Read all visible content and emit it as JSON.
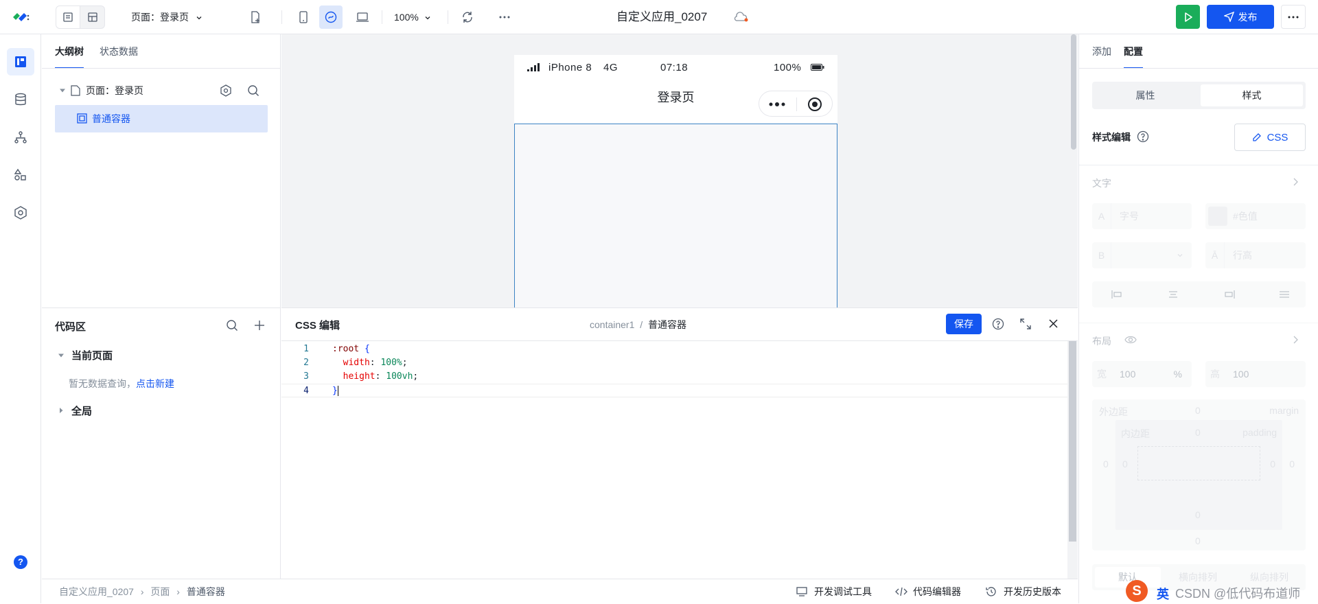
{
  "header": {
    "page_select": "页面：登录页",
    "zoom": "100%",
    "app_title": "自定义应用_0207",
    "publish_label": "发布"
  },
  "outline": {
    "tabs": [
      "大纲树",
      "状态数据"
    ],
    "tree": {
      "page_label": "页面：登录页",
      "child_label": "普通容器"
    }
  },
  "phone": {
    "carrier": "iPhone 8",
    "network": "4G",
    "time": "07:18",
    "battery": "100%",
    "page_title": "登录页"
  },
  "config": {
    "tabs": [
      "添加",
      "配置"
    ],
    "segments": [
      "属性",
      "样式"
    ],
    "style_edit_label": "样式编辑",
    "css_button": "CSS",
    "text_section": "文字",
    "font_size_placeholder": "字号",
    "color_placeholder": "#色值",
    "line_height_placeholder": "行高",
    "layout_section": "布局",
    "width_label": "宽",
    "width_value": "100",
    "width_unit": "%",
    "height_label": "高",
    "height_value": "100",
    "margin_label": "外边距",
    "margin_en": "margin",
    "padding_label": "内边距",
    "padding_en": "padding",
    "zero": "0",
    "flex_options": [
      "默认",
      "横向排列",
      "纵向排列"
    ]
  },
  "code_area": {
    "title": "代码区",
    "current_page": "当前页面",
    "empty_text": "暂无数据查询，",
    "create_link": "点击新建",
    "global": "全局"
  },
  "css_editor": {
    "title": "CSS 编辑",
    "breadcrumb_id": "container1",
    "breadcrumb_sep": "/",
    "breadcrumb_name": "普通容器",
    "save_label": "保存",
    "lines": [
      {
        "num": "1",
        "text": ":root {"
      },
      {
        "num": "2",
        "text": "  width: 100%;"
      },
      {
        "num": "3",
        "text": "  height: 100vh;"
      },
      {
        "num": "4",
        "text": "}"
      }
    ]
  },
  "statusbar": {
    "breadcrumb": [
      "自定义应用_0207",
      "页面",
      "普通容器"
    ],
    "debug_tool": "开发调试工具",
    "code_editor": "代码编辑器",
    "history": "开发历史版本",
    "watermark": "CSDN @低代码布道师",
    "ime": "英"
  },
  "colors": {
    "accent": "#1456f0",
    "run_green": "#1aad5a"
  }
}
